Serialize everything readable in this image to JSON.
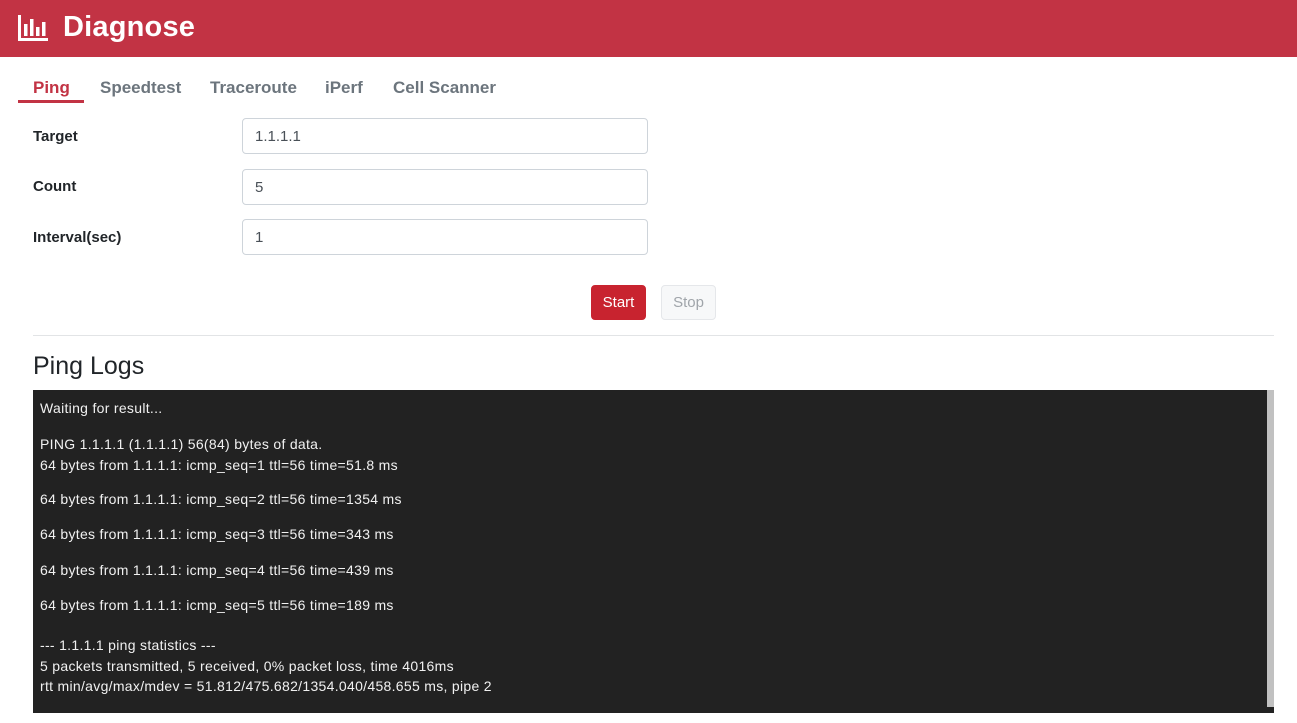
{
  "header": {
    "title": "Diagnose",
    "icon": "bar-chart-icon"
  },
  "tabs": [
    {
      "label": "Ping",
      "active": true
    },
    {
      "label": "Speedtest",
      "active": false
    },
    {
      "label": "Traceroute",
      "active": false
    },
    {
      "label": "iPerf",
      "active": false
    },
    {
      "label": "Cell Scanner",
      "active": false
    }
  ],
  "form": {
    "target": {
      "label": "Target",
      "value": "1.1.1.1"
    },
    "count": {
      "label": "Count",
      "value": "5"
    },
    "interval": {
      "label": "Interval(sec)",
      "value": "1"
    }
  },
  "buttons": {
    "start": "Start",
    "stop": "Stop"
  },
  "logs": {
    "title": "Ping Logs",
    "lines": [
      "Waiting for result...",
      "PING 1.1.1.1 (1.1.1.1) 56(84) bytes of data.",
      "64 bytes from 1.1.1.1: icmp_seq=1 ttl=56 time=51.8 ms",
      "64 bytes from 1.1.1.1: icmp_seq=2 ttl=56 time=1354 ms",
      "64 bytes from 1.1.1.1: icmp_seq=3 ttl=56 time=343 ms",
      "64 bytes from 1.1.1.1: icmp_seq=4 ttl=56 time=439 ms",
      "64 bytes from 1.1.1.1: icmp_seq=5 ttl=56 time=189 ms",
      "--- 1.1.1.1 ping statistics ---",
      "5 packets transmitted, 5 received, 0% packet loss, time 4016ms",
      "rtt min/avg/max/mdev = 51.812/475.682/1354.040/458.655 ms, pipe 2"
    ]
  },
  "colors": {
    "brand": "#c23344",
    "start_button": "#c8232f",
    "log_background": "#222222",
    "log_text": "#f1f1f1"
  }
}
